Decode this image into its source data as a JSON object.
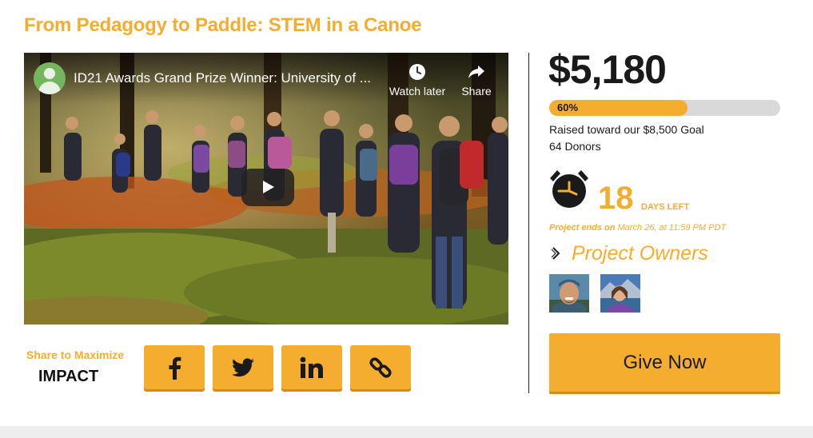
{
  "project": {
    "title": "From Pedagogy to Paddle: STEM in a Canoe"
  },
  "video": {
    "title": "ID21 Awards Grand Prize Winner: University of ...",
    "watch_later_label": "Watch later",
    "share_label": "Share",
    "icons": [
      "channel-avatar-icon",
      "clock-icon",
      "share-arrow-icon",
      "play-icon"
    ]
  },
  "share": {
    "label": "Share to Maximize",
    "impact": "IMPACT",
    "buttons": [
      {
        "icon": "facebook-icon"
      },
      {
        "icon": "twitter-icon"
      },
      {
        "icon": "linkedin-icon"
      },
      {
        "icon": "link-icon"
      }
    ]
  },
  "funding": {
    "amount": "$5,180",
    "progress_label": "60%",
    "progress_fraction": 0.6,
    "raised_text": "Raised toward our $8,500 Goal",
    "donors_text": "64 Donors"
  },
  "countdown": {
    "days": "18",
    "days_label": "DAYS LEFT",
    "ends_prefix": "Project ends on",
    "ends_date": " March 26, at 11:59 PM PDT"
  },
  "owners": {
    "title": "Project Owners"
  },
  "cta": {
    "give_label": "Give Now"
  },
  "colors": {
    "accent": "#f5ad2f",
    "accent_shadow": "#d18d15",
    "text": "#1a1a1a",
    "track": "#d9d9d9"
  }
}
